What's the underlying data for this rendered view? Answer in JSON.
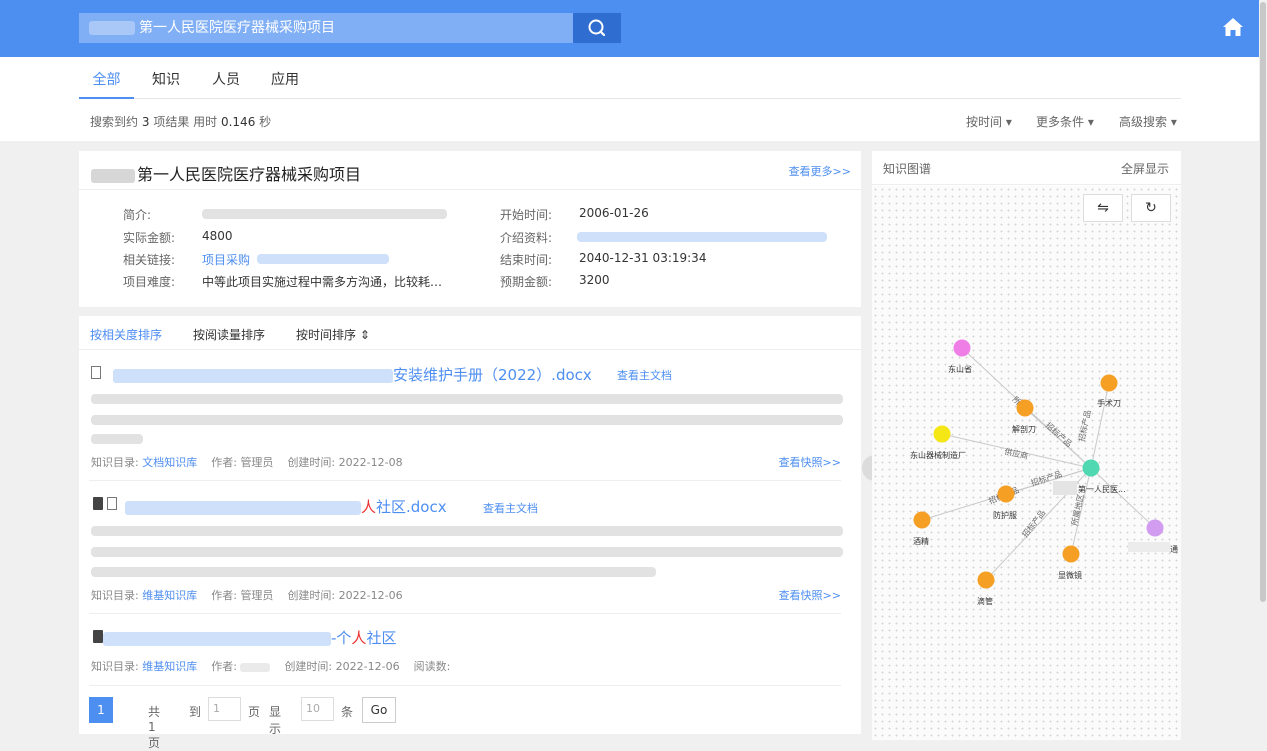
{
  "search": {
    "query": "第一人民医院医疗器械采购项目"
  },
  "tabs": [
    {
      "label": "全部",
      "active": true
    },
    {
      "label": "知识",
      "active": false
    },
    {
      "label": "人员",
      "active": false
    },
    {
      "label": "应用",
      "active": false
    }
  ],
  "result_stat": {
    "prefix": "搜索到约",
    "count": "3",
    "mid": "项结果 用时",
    "time": "0.146",
    "unit": "秒"
  },
  "filters": {
    "by_time": "按时间 ▾",
    "more": "更多条件 ▾",
    "advanced": "高级搜索 ▾"
  },
  "project": {
    "title": "第一人民医院医疗器械采购项目",
    "more_link": "查看更多>>",
    "fields": {
      "intro_label": "简介:",
      "amount_label": "实际金额:",
      "amount_value": "4800",
      "links_label": "相关链接:",
      "links_value": "项目采购",
      "difficulty_label": "项目难度:",
      "difficulty_value": "中等此项目实施过程中需多方沟通，比较耗…",
      "start_label": "开始时间:",
      "start_value": "2006-01-26",
      "material_label": "介绍资料:",
      "end_label": "结束时间:",
      "end_value": "2040-12-31 03:19:34",
      "expected_label": "预期金额:",
      "expected_value": "3200"
    }
  },
  "sort": {
    "relevance": "按相关度排序",
    "reads": "按阅读量排序",
    "time": "按时间排序 ⇕"
  },
  "results": [
    {
      "title_tail": "安装维护手册（2022）.docx",
      "main_doc": "查看主文档",
      "catalog_label": "知识目录:",
      "catalog": "文档知识库",
      "author_label": "作者:",
      "author": "管理员",
      "created_label": "创建时间:",
      "created": "2022-12-08",
      "snapshot": "查看快照>>"
    },
    {
      "title_red": "人",
      "title_tail": "社区.docx",
      "main_doc": "查看主文档",
      "catalog_label": "知识目录:",
      "catalog": "维基知识库",
      "author_label": "作者:",
      "author": "管理员",
      "created_label": "创建时间:",
      "created": "2022-12-06",
      "snapshot": "查看快照>>"
    },
    {
      "title_pre": "-个",
      "title_red": "人",
      "title_tail": "社区",
      "catalog_label": "知识目录:",
      "catalog": "维基知识库",
      "author_label": "作者:",
      "created_label": "创建时间:",
      "created": "2022-12-06",
      "reads_label": "阅读数:"
    }
  ],
  "pager": {
    "current": "1",
    "total": "共1页",
    "goto": "到",
    "page_unit": "页",
    "show": "显示",
    "goto_value": "1",
    "size_value": "10",
    "size_unit": "条",
    "go": "Go"
  },
  "graph": {
    "title": "知识图谱",
    "fullscreen": "全屏显示",
    "swap_icon": "⇋",
    "refresh_icon": "↻",
    "nodes": {
      "center": "第一人民医...",
      "dongshan_province": "东山省",
      "scalpel": "手术刀",
      "dissect_knife": "解剖刀",
      "manufacturer": "东山器械制造厂",
      "protective": "防护服",
      "alcohol": "酒精",
      "microscope": "显微镜",
      "dropper": "滴管",
      "purple_right": "通"
    },
    "edges": {
      "e1": "所属",
      "e2": "招标产品",
      "e3": "招标产品",
      "e4": "供应商",
      "e5": "招标产品",
      "e6": "招标产品",
      "e7": "招标产品",
      "e8": "所属地区"
    },
    "colors": {
      "orange": "#f5a025",
      "teal": "#4fd8b1",
      "pink": "#ef7fe6",
      "yellow": "#f5e615",
      "purple": "#d29cf0"
    }
  }
}
